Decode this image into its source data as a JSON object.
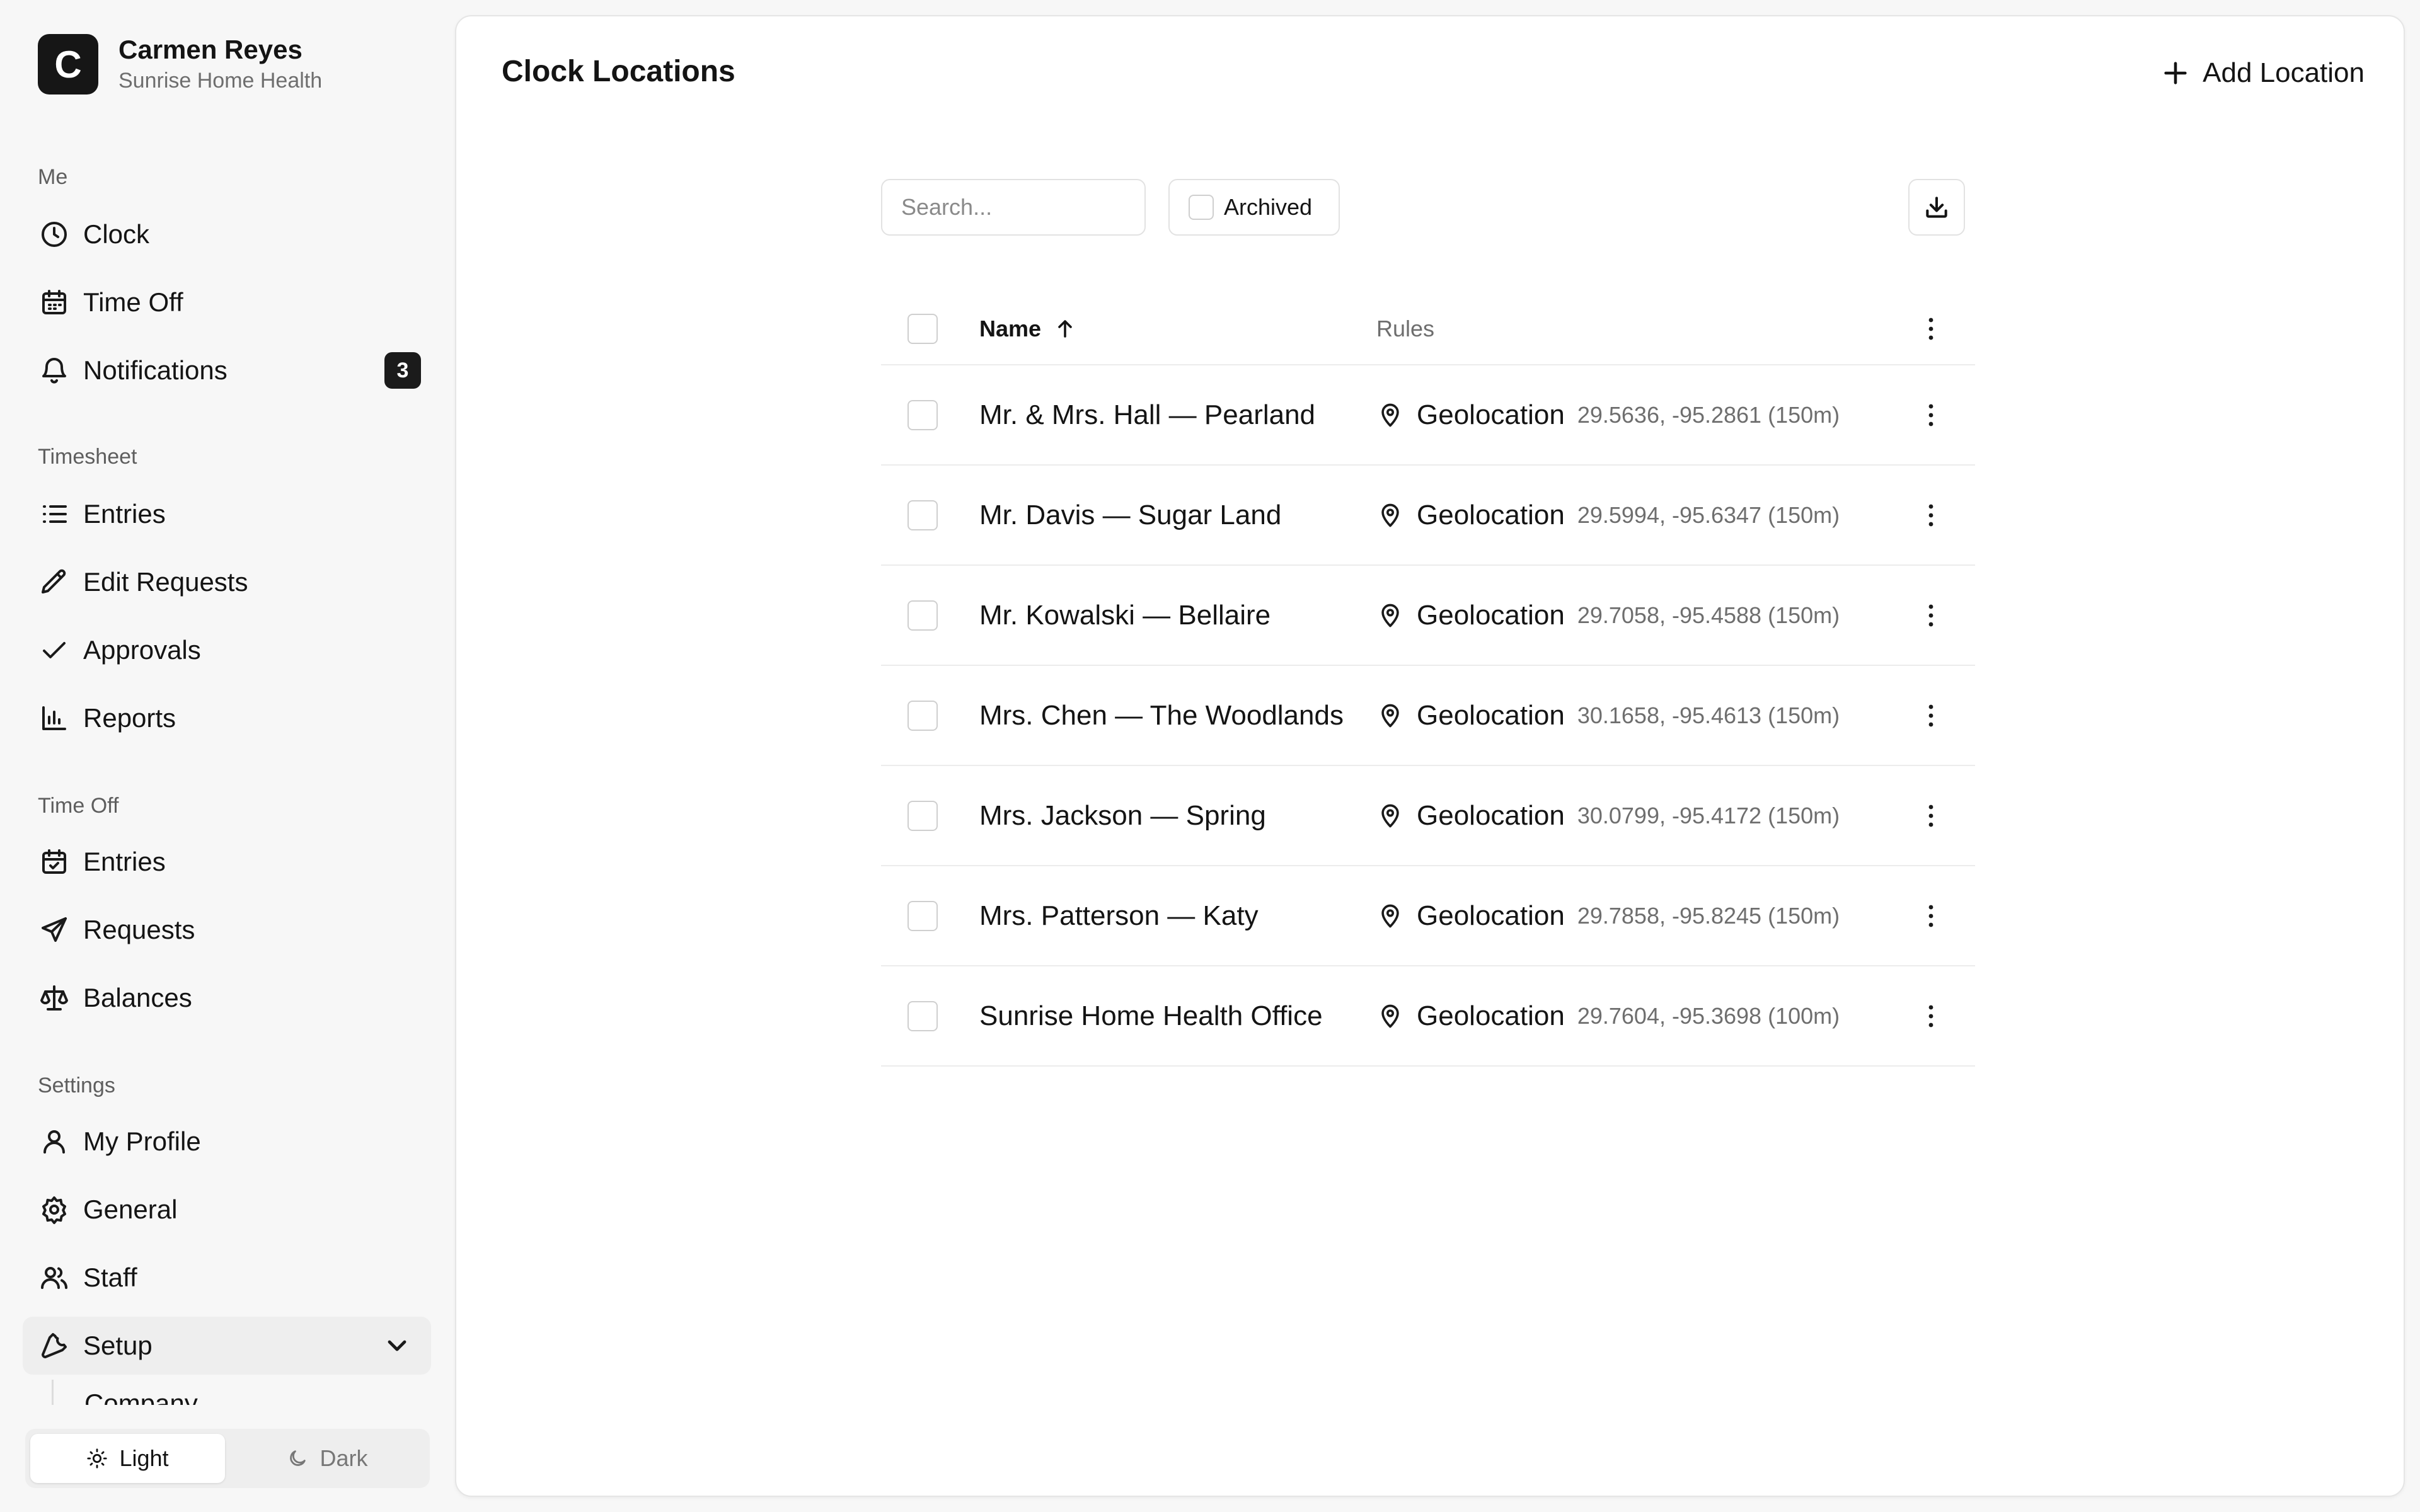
{
  "org": {
    "logo_letter": "C",
    "user_name": "Carmen Reyes",
    "company": "Sunrise Home Health"
  },
  "sidebar": {
    "groups": [
      {
        "label": "Me"
      },
      {
        "label": "Timesheet"
      },
      {
        "label": "Time Off"
      },
      {
        "label": "Settings"
      }
    ],
    "items": [
      {
        "label": "Clock",
        "icon": "clock-icon"
      },
      {
        "label": "Time Off",
        "icon": "calendar-icon"
      },
      {
        "label": "Notifications",
        "icon": "bell-icon",
        "badge": "3"
      },
      {
        "label": "Entries",
        "icon": "list-icon"
      },
      {
        "label": "Edit Requests",
        "icon": "pencil-icon"
      },
      {
        "label": "Approvals",
        "icon": "check-icon"
      },
      {
        "label": "Reports",
        "icon": "bar-chart-icon"
      },
      {
        "label": "Entries",
        "icon": "calendar-check-icon"
      },
      {
        "label": "Requests",
        "icon": "send-icon"
      },
      {
        "label": "Balances",
        "icon": "scale-icon"
      },
      {
        "label": "My Profile",
        "icon": "user-icon"
      },
      {
        "label": "General",
        "icon": "gear-icon"
      },
      {
        "label": "Staff",
        "icon": "users-icon"
      },
      {
        "label": "Setup",
        "icon": "wrench-icon",
        "expanded": true
      }
    ],
    "setup_sub_item": "Company",
    "theme": {
      "light": "Light",
      "dark": "Dark",
      "selected": "Light"
    }
  },
  "main": {
    "title": "Clock Locations",
    "add_label": "Add Location",
    "search_placeholder": "Search...",
    "archived_label": "Archived",
    "columns": {
      "name": "Name",
      "rules": "Rules"
    },
    "rows": [
      {
        "name": "Mr. & Mrs. Hall — Pearland",
        "rule_type": "Geolocation",
        "coords": "29.5636, -95.2861 (150m)"
      },
      {
        "name": "Mr. Davis — Sugar Land",
        "rule_type": "Geolocation",
        "coords": "29.5994, -95.6347 (150m)"
      },
      {
        "name": "Mr. Kowalski — Bellaire",
        "rule_type": "Geolocation",
        "coords": "29.7058, -95.4588 (150m)"
      },
      {
        "name": "Mrs. Chen — The Woodlands",
        "rule_type": "Geolocation",
        "coords": "30.1658, -95.4613 (150m)"
      },
      {
        "name": "Mrs. Jackson — Spring",
        "rule_type": "Geolocation",
        "coords": "30.0799, -95.4172 (150m)"
      },
      {
        "name": "Mrs. Patterson — Katy",
        "rule_type": "Geolocation",
        "coords": "29.7858, -95.8245 (150m)"
      },
      {
        "name": "Sunrise Home Health Office",
        "rule_type": "Geolocation",
        "coords": "29.7604, -95.3698 (100m)"
      }
    ]
  }
}
